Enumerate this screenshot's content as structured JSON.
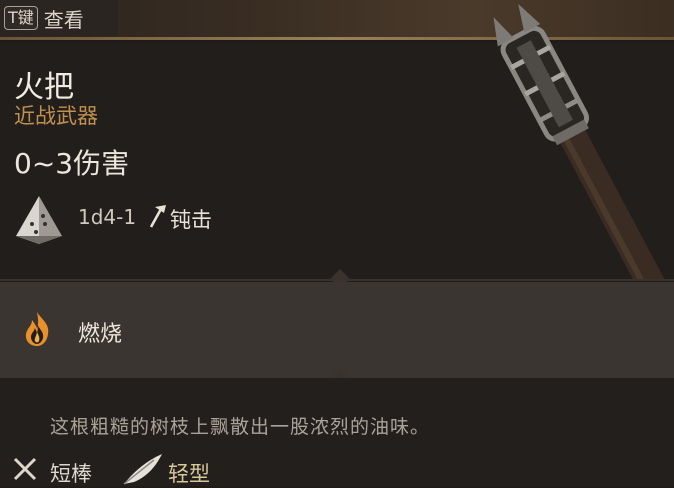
{
  "top_tab": {
    "key": "T键",
    "label": "查看"
  },
  "item": {
    "name": "火把",
    "category": "近战武器",
    "damage_summary": "0~3伤害",
    "dice": "1d4-1",
    "damage_type": "钝击",
    "weapon_icon": "torch-image"
  },
  "effect": {
    "icon": "flame-icon",
    "label": "燃烧"
  },
  "description": "这根粗糙的树枝上飘散出一股浓烈的油味。",
  "properties": [
    {
      "icon": "crossed-clubs-icon",
      "label": "短棒"
    },
    {
      "icon": "feather-icon",
      "label": "轻型"
    }
  ],
  "footer_value": "",
  "colors": {
    "accent_gold": "#c0914e",
    "light_tag": "#d8c79a",
    "band": "#3b3531",
    "bg": "#221e1b"
  }
}
